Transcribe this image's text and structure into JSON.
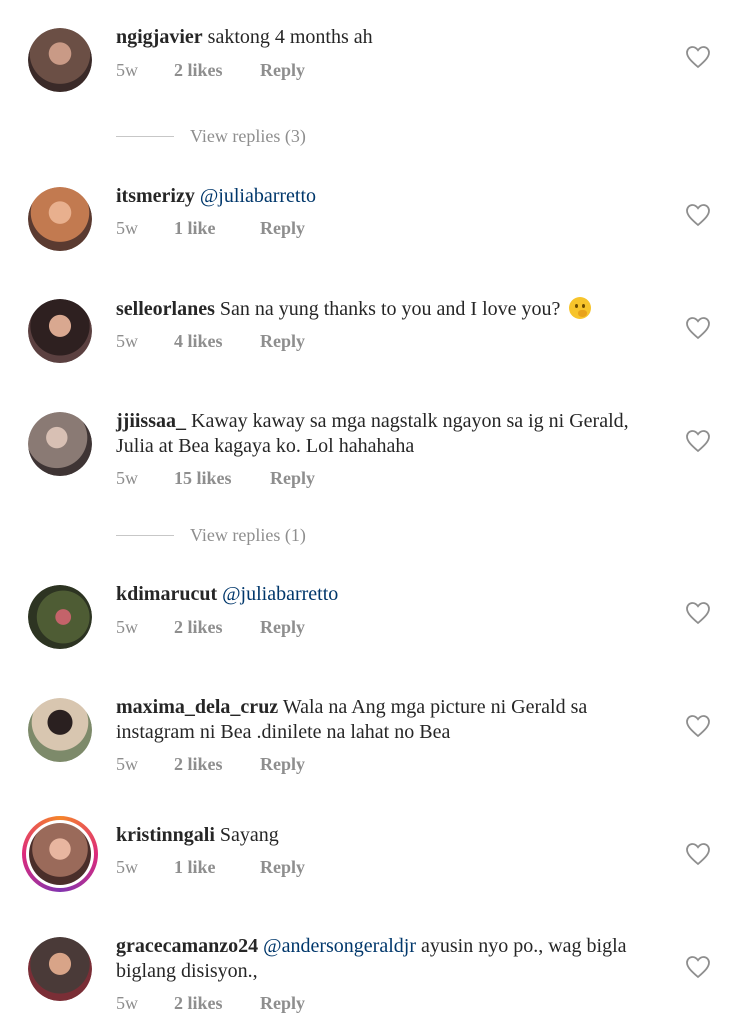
{
  "comments": [
    {
      "username": "ngigjavier",
      "text": "saktong 4 months ah",
      "mention": "",
      "time": "5w",
      "likes": "2 likes",
      "reply": "Reply",
      "view_replies": "View replies (3)",
      "avatar_color": "#6b4f45"
    },
    {
      "username": "itsmerizy",
      "text": "",
      "mention": "@juliabarretto",
      "time": "5w",
      "likes": "1 like",
      "reply": "Reply",
      "view_replies": "",
      "avatar_color": "#b56a45"
    },
    {
      "username": "selleorlanes",
      "text": "San na yung thanks to you and I love you?",
      "mention": "",
      "time": "5w",
      "likes": "4 likes",
      "reply": "Reply",
      "view_replies": "",
      "avatar_color": "#3c2a2a"
    },
    {
      "username": "jjiissaa_",
      "text": "Kaway kaway sa mga nagstalk ngayon sa ig ni Gerald, Julia at Bea kagaya ko. Lol hahahaha",
      "mention": "",
      "time": "5w",
      "likes": "15 likes",
      "reply": "Reply",
      "view_replies": "View replies (1)",
      "avatar_color": "#8a7a74"
    },
    {
      "username": "kdimarucut",
      "text": "",
      "mention": "@juliabarretto",
      "time": "5w",
      "likes": "2 likes",
      "reply": "Reply",
      "view_replies": "",
      "avatar_color": "#5a6a3e"
    },
    {
      "username": "maxima_dela_cruz",
      "text": "Wala na Ang mga picture ni Gerald sa instagram ni Bea .dinilete na lahat no Bea",
      "mention": "",
      "time": "5w",
      "likes": "2 likes",
      "reply": "Reply",
      "view_replies": "",
      "avatar_color": "#7d8a6a"
    },
    {
      "username": "kristinngali",
      "text": "Sayang",
      "mention": "",
      "time": "5w",
      "likes": "1 like",
      "reply": "Reply",
      "view_replies": "",
      "avatar_color": "#9a6a5a"
    },
    {
      "username": "gracecamanzo24",
      "text": "ayusin nyo po., wag bigla biglang disisyon.,",
      "mention": "@andersongeraldjr",
      "time": "5w",
      "likes": "2 likes",
      "reply": "Reply",
      "view_replies": "",
      "avatar_color": "#4a3a38"
    }
  ],
  "colors": {
    "text": "#262626",
    "muted": "#8e8e8e",
    "mention": "#00376b"
  }
}
